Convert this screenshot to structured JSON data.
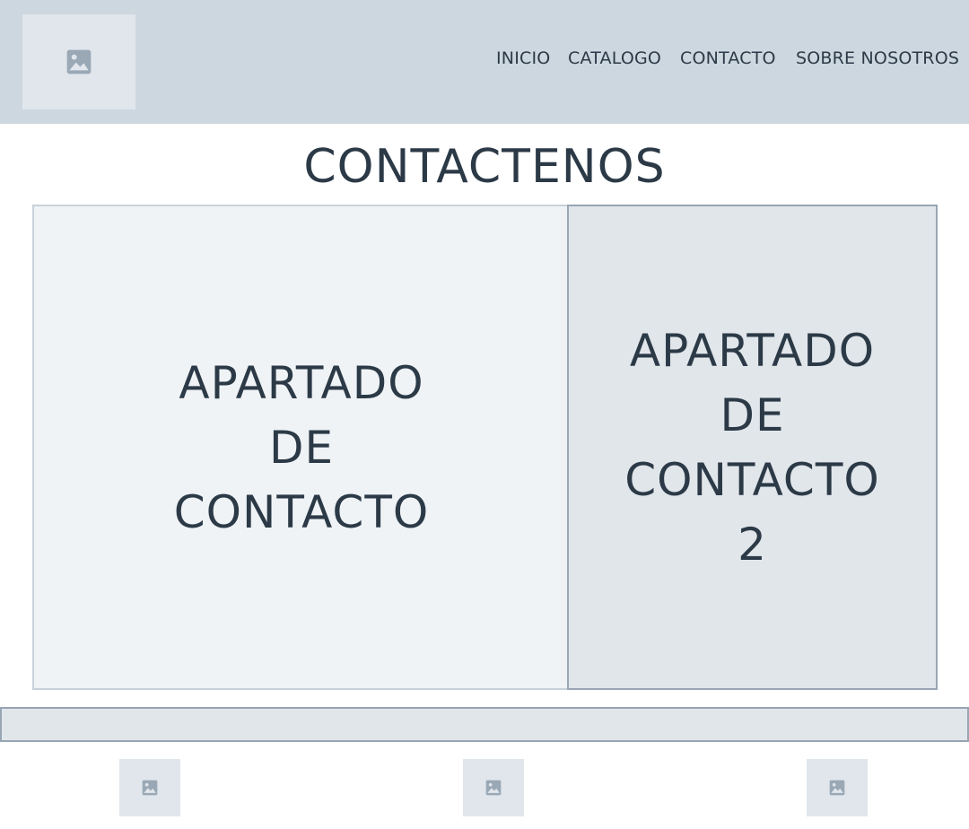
{
  "header": {
    "logo_icon": "image-placeholder-icon",
    "nav": [
      {
        "label": "INICIO"
      },
      {
        "label": "CATALOGO"
      },
      {
        "label": "CONTACTO"
      },
      {
        "label": "SOBRE NOSOTROS"
      }
    ]
  },
  "main": {
    "title": "CONTACTENOS",
    "panels": [
      {
        "text": "APARTADO\nDE\nCONTACTO"
      },
      {
        "text": "APARTADO\nDE\nCONTACTO\n2"
      }
    ]
  },
  "footer": {
    "icons": [
      "image-placeholder-icon",
      "image-placeholder-icon",
      "image-placeholder-icon"
    ]
  },
  "colors": {
    "header_bg": "#cdd7e0",
    "text": "#2c3a47",
    "placeholder_bg": "#e0e6ec",
    "icon": "#9aa8b6",
    "panel_1_bg": "#eff3f6",
    "panel_2_bg": "#e1e6eb"
  }
}
